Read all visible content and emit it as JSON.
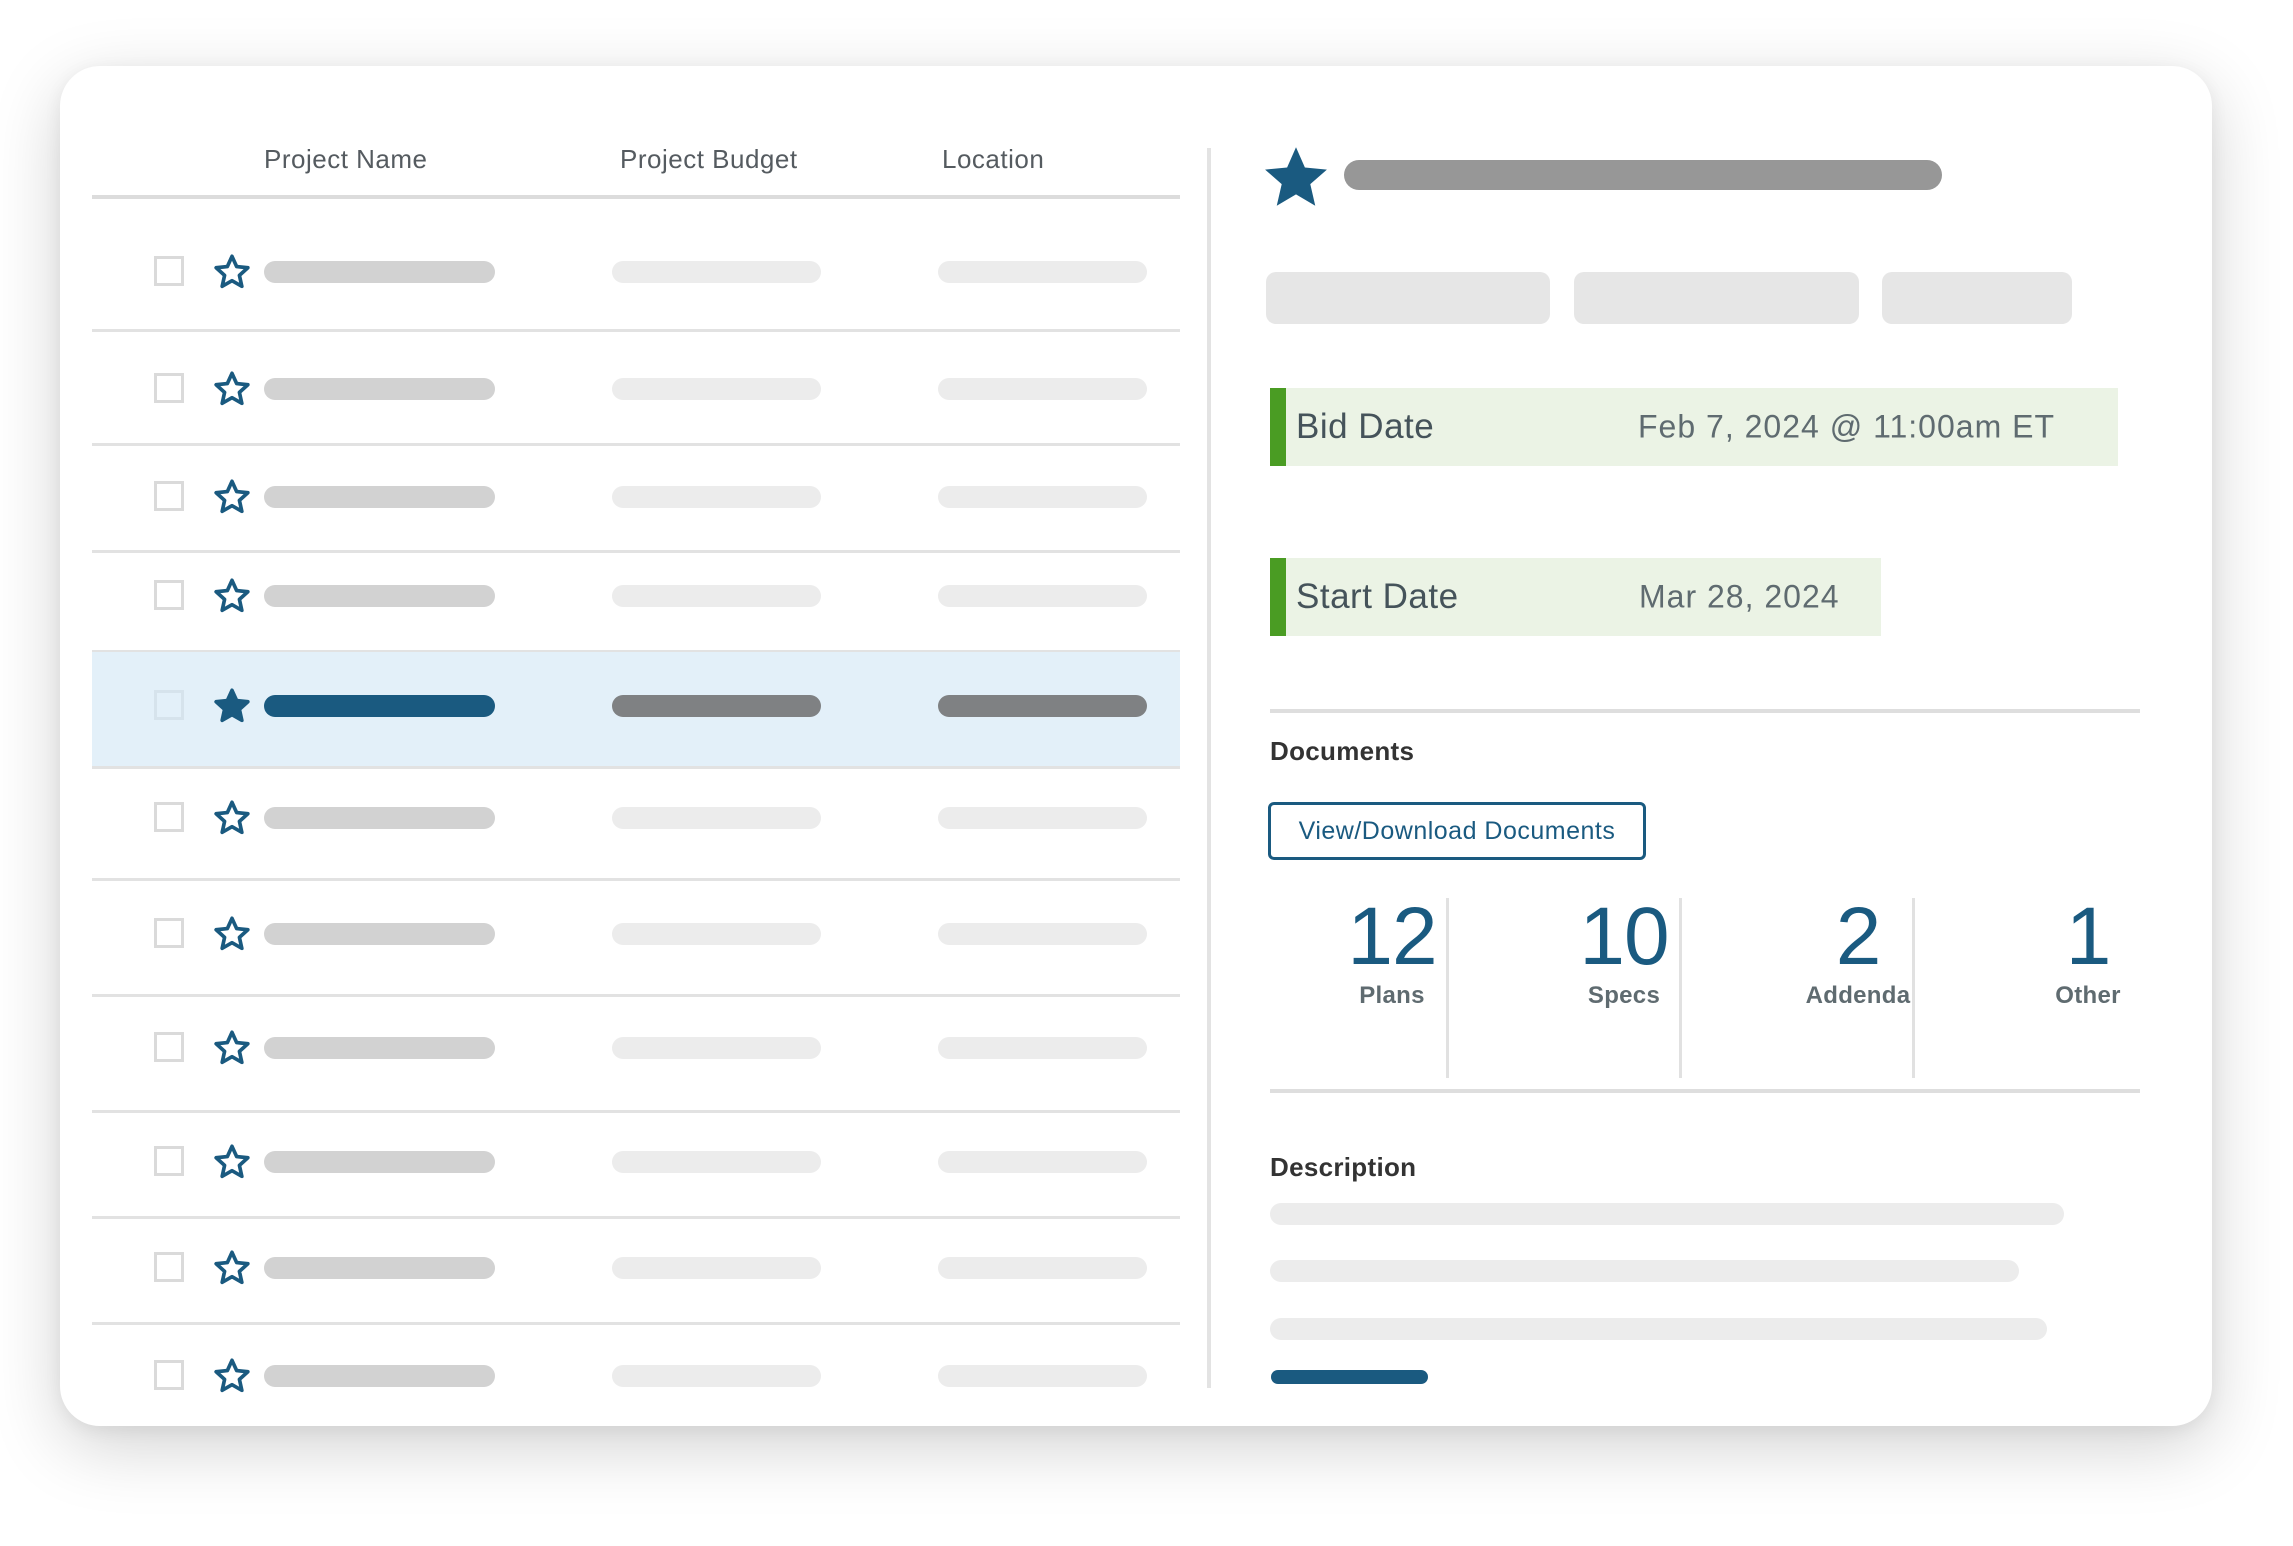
{
  "table": {
    "columns": [
      "Project Name",
      "Project Budget",
      "Location"
    ],
    "rows": [
      {
        "starred": false,
        "selected": false
      },
      {
        "starred": false,
        "selected": false
      },
      {
        "starred": false,
        "selected": false
      },
      {
        "starred": false,
        "selected": false
      },
      {
        "starred": true,
        "selected": true
      },
      {
        "starred": false,
        "selected": false
      },
      {
        "starred": false,
        "selected": false
      },
      {
        "starred": false,
        "selected": false
      },
      {
        "starred": false,
        "selected": false
      },
      {
        "starred": false,
        "selected": false
      },
      {
        "starred": false,
        "selected": false
      }
    ]
  },
  "detail": {
    "starred": true,
    "bid_date": {
      "label": "Bid Date",
      "value": "Feb 7, 2024 @ 11:00am ET"
    },
    "start_date": {
      "label": "Start Date",
      "value": "Mar 28, 2024"
    },
    "documents": {
      "title": "Documents",
      "button_label": "View/Download Documents",
      "stats": [
        {
          "count": "12",
          "label": "Plans"
        },
        {
          "count": "10",
          "label": "Specs"
        },
        {
          "count": "2",
          "label": "Addenda"
        },
        {
          "count": "1",
          "label": "Other"
        }
      ]
    },
    "description": {
      "title": "Description"
    }
  },
  "colors": {
    "accent": "#1a5a80",
    "date_highlight": "#ebf3e5",
    "date_marker": "#4a9c23",
    "selected_row": "#e3f0f9"
  },
  "icons": {
    "row_star": "star-outline-icon",
    "row_star_active": "star-filled-icon",
    "checkbox": "checkbox-icon"
  }
}
